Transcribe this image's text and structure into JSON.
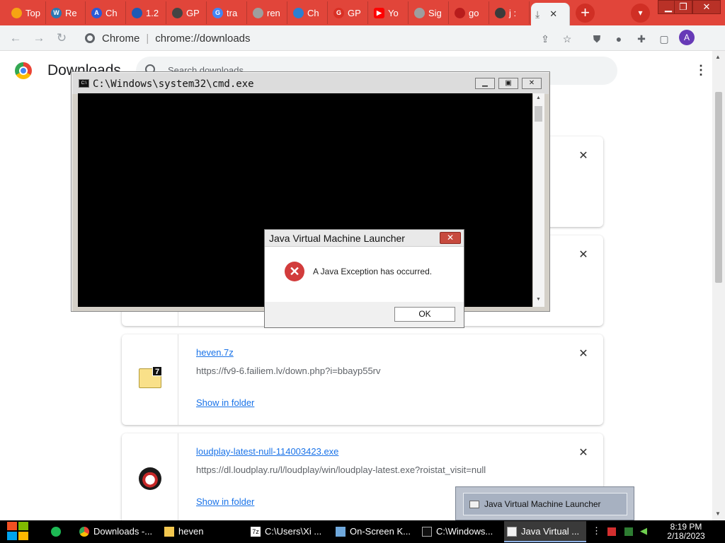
{
  "tabs": [
    {
      "label": "Top",
      "color": "#f6a313"
    },
    {
      "label": "Re",
      "color": "#2b77b3"
    },
    {
      "label": "Ch",
      "color": "#2a5bd7"
    },
    {
      "label": "1.2",
      "color": "#1f5ab5"
    },
    {
      "label": "GP",
      "color": "#444444"
    },
    {
      "label": "tra",
      "color": "#4285f4"
    },
    {
      "label": "ren",
      "color": "#9e9e9e"
    },
    {
      "label": "Ch",
      "color": "#2c7fd0"
    },
    {
      "label": "GP",
      "color": "#d93025"
    },
    {
      "label": "Yo",
      "color": "#ff0000"
    },
    {
      "label": "Sig",
      "color": "#9e9e9e"
    },
    {
      "label": "go",
      "color": "#b71c1c"
    },
    {
      "label": "j :",
      "color": "#3b3b3b"
    }
  ],
  "active_tab": {
    "icon": "download-icon"
  },
  "omnibox": {
    "site": "Chrome",
    "url": "chrome://downloads"
  },
  "page": {
    "title": "Downloads",
    "search_placeholder": "Search downloads"
  },
  "downloads": [
    {
      "file": "heven.7z",
      "url": "https://fv9-6.failiem.lv/down.php?i=bbayp55rv",
      "action": "Show in folder"
    },
    {
      "file": "loudplay-latest-null-114003423.exe",
      "url": "https://dl.loudplay.ru/l/loudplay/win/loudplay-latest.exe?roistat_visit=null",
      "action": "Show in folder"
    }
  ],
  "cmd": {
    "title": "C:\\Windows\\system32\\cmd.exe"
  },
  "dialog": {
    "title": "Java Virtual Machine Launcher",
    "message": "A Java Exception has occurred.",
    "ok": "OK"
  },
  "tooltip": {
    "label": "Java Virtual Machine Launcher"
  },
  "taskbar": {
    "items": [
      {
        "label": "Downloads -..."
      },
      {
        "label": "heven"
      },
      {
        "label": "C:\\Users\\Xi ..."
      },
      {
        "label": "On-Screen K..."
      },
      {
        "label": "C:\\Windows..."
      },
      {
        "label": "Java Virtual ..."
      }
    ],
    "time": "8:19 PM",
    "date": "2/18/2023"
  }
}
